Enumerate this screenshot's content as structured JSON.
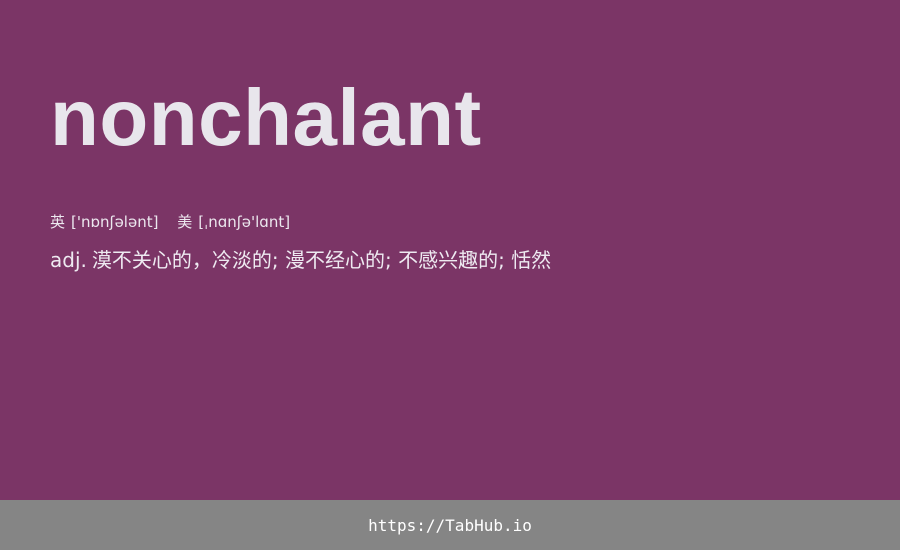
{
  "entry": {
    "word": "nonchalant",
    "phonetics": {
      "uk_label": "英",
      "uk": "['nɒnʃələnt]",
      "us_label": "美",
      "us": "[ˌnɑnʃə'lɑnt]"
    },
    "definition": {
      "pos": "adj.",
      "meaning": "漠不关心的，冷淡的; 漫不经心的; 不感兴趣的; 恬然"
    }
  },
  "footer": {
    "url": "https://TabHub.io"
  },
  "colors": {
    "background": "#7b3566",
    "footer_background": "#858585",
    "text": "#e8e6ec"
  }
}
